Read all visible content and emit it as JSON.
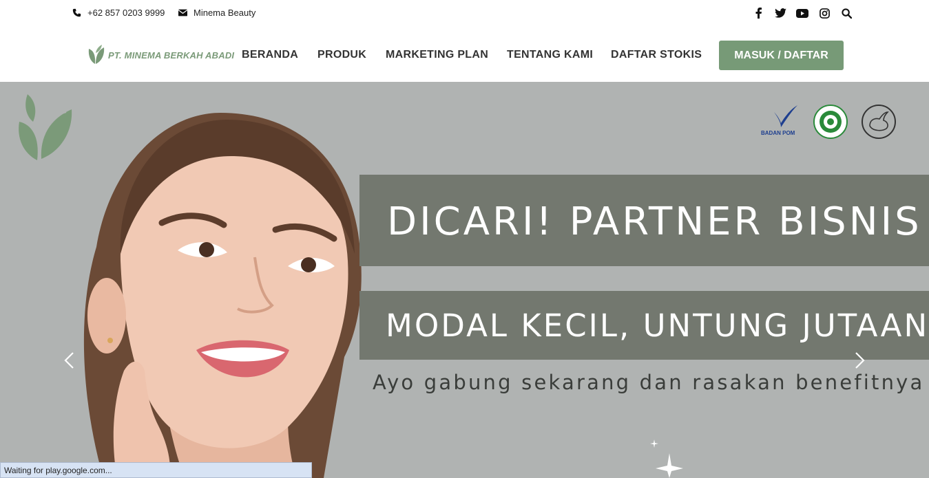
{
  "topbar": {
    "phone": "+62 857 0203 9999",
    "email": "Minema Beauty",
    "social_icons": [
      "facebook-icon",
      "twitter-icon",
      "youtube-icon",
      "instagram-icon",
      "search-icon"
    ]
  },
  "nav": {
    "logo_text": "PT. MINEMA BERKAH ABADI",
    "items": [
      {
        "label": "BERANDA"
      },
      {
        "label": "PRODUK"
      },
      {
        "label": "MARKETING PLAN"
      },
      {
        "label": "TENTANG KAMI"
      },
      {
        "label": "DAFTAR STOKIS"
      }
    ],
    "login_label": "MASUK / DAFTAR"
  },
  "hero": {
    "headline": "DICARI! PARTNER BISNIS",
    "subheadline": "MODAL KECIL, UNTUNG JUTAAN",
    "tagline": "Ayo gabung sekarang dan rasakan benefitnya",
    "cert_label": "BADAN POM"
  },
  "status_bar": "Waiting for play.google.com...",
  "colors": {
    "brand_green": "#779a77",
    "banner_gray": "#73786f",
    "hero_bg": "#b0b3b2"
  }
}
